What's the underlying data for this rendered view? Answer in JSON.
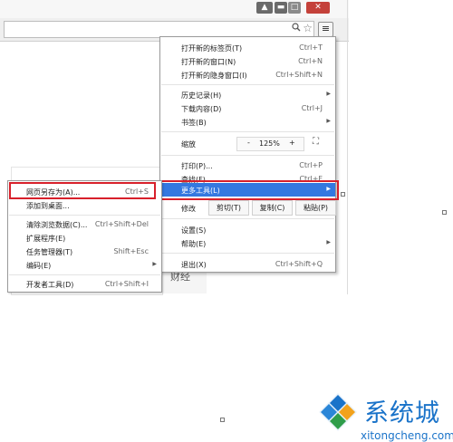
{
  "window": {
    "controls": {
      "user": "▲",
      "minimize": "▬",
      "maximize": "□",
      "close": "✕"
    }
  },
  "toolbar": {
    "zoom_icon": "magnifier",
    "star_icon": "☆",
    "menu_icon": "≡"
  },
  "background": {
    "text": "财经"
  },
  "main_menu": {
    "items_top": [
      {
        "label": "打开新的标签页(T)",
        "shortcut": "Ctrl+T"
      },
      {
        "label": "打开新的窗口(N)",
        "shortcut": "Ctrl+N"
      },
      {
        "label": "打开新的隐身窗口(I)",
        "shortcut": "Ctrl+Shift+N"
      }
    ],
    "items_history": [
      {
        "label": "历史记录(H)",
        "shortcut": "",
        "arrow": "▶"
      },
      {
        "label": "下载内容(D)",
        "shortcut": "Ctrl+J"
      },
      {
        "label": "书签(B)",
        "shortcut": "",
        "arrow": "▶"
      }
    ],
    "zoom": {
      "label": "缩放",
      "minus": "-",
      "value": "125%",
      "plus": "+",
      "fullscreen": "⛶"
    },
    "items_tools": [
      {
        "label": "打印(P)...",
        "shortcut": "Ctrl+P"
      },
      {
        "label": "查找(F)...",
        "shortcut": "Ctrl+F"
      },
      {
        "label": "更多工具(L)",
        "shortcut": "",
        "arrow": "▶"
      }
    ],
    "edit": {
      "label": "修改",
      "cut": "剪切(T)",
      "copy": "复制(C)",
      "paste": "粘贴(P)"
    },
    "items_settings": [
      {
        "label": "设置(S)",
        "shortcut": ""
      },
      {
        "label": "帮助(E)",
        "shortcut": "",
        "arrow": "▶"
      }
    ],
    "exit": {
      "label": "退出(X)",
      "shortcut": "Ctrl+Shift+Q"
    }
  },
  "sub_menu": {
    "items": [
      {
        "label": "网页另存为(A)...",
        "shortcut": "Ctrl+S"
      },
      {
        "label": "添加到桌面...",
        "shortcut": ""
      }
    ],
    "items2": [
      {
        "label": "清除浏览数据(C)...",
        "shortcut": "Ctrl+Shift+Del"
      },
      {
        "label": "扩展程序(E)",
        "shortcut": ""
      },
      {
        "label": "任务管理器(T)",
        "shortcut": "Shift+Esc"
      },
      {
        "label": "编码(E)",
        "shortcut": "",
        "arrow": "▶"
      }
    ],
    "devtools": {
      "label": "开发者工具(D)",
      "shortcut": "Ctrl+Shift+I"
    }
  },
  "watermark": {
    "title": "系统城",
    "url": "xitongcheng.com"
  },
  "colors": {
    "highlight": "#3478e0",
    "annotation_red": "#d8202b",
    "watermark_blue": "#1a73c9"
  }
}
